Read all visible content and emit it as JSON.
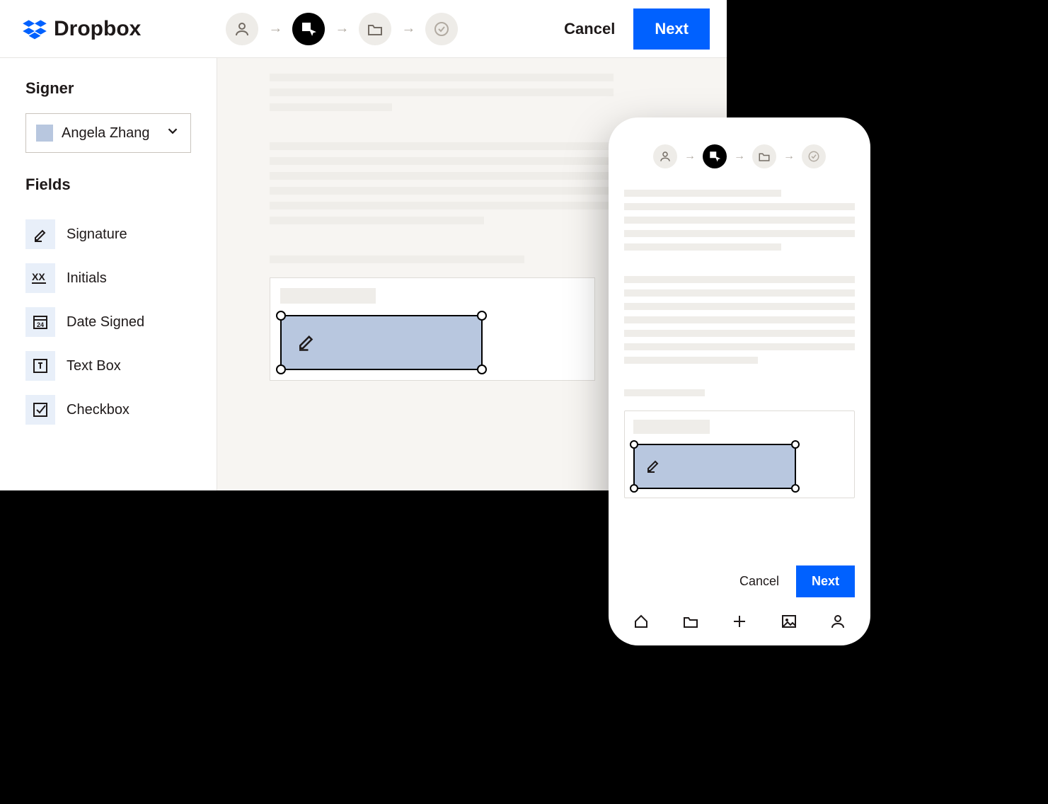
{
  "brand": {
    "name": "Dropbox"
  },
  "header": {
    "cancel_label": "Cancel",
    "next_label": "Next",
    "steps": [
      "person",
      "edit",
      "folder",
      "check"
    ]
  },
  "sidebar": {
    "signer_heading": "Signer",
    "signer_selected": "Angela Zhang",
    "fields_heading": "Fields",
    "fields": [
      {
        "icon": "signature-icon",
        "label": "Signature"
      },
      {
        "icon": "initials-icon",
        "label": "Initials"
      },
      {
        "icon": "date-icon",
        "label": "Date Signed"
      },
      {
        "icon": "textbox-icon",
        "label": "Text Box"
      },
      {
        "icon": "checkbox-icon",
        "label": "Checkbox"
      }
    ]
  },
  "phone": {
    "cancel_label": "Cancel",
    "next_label": "Next"
  }
}
